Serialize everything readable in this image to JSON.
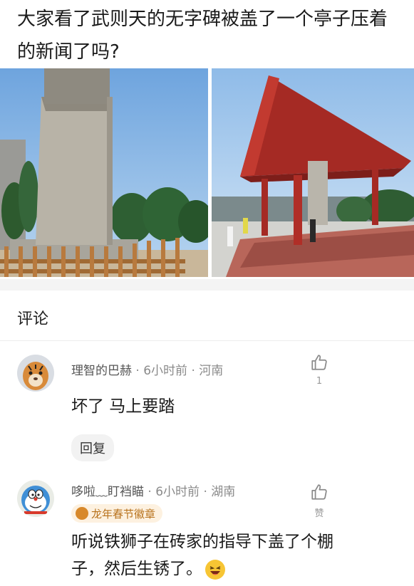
{
  "post": {
    "title": "大家看了武则天的无字碑被盖了一个亭子压着的新闻了吗?"
  },
  "comments_section": {
    "title": "评论"
  },
  "comments": [
    {
      "username": "理智的巴赫",
      "time": "6小时前",
      "location": "河南",
      "separator": "·",
      "like_count": "1",
      "text": "坏了 马上要踏",
      "reply_label": "回复",
      "avatar_icon": "tiger-avatar-icon"
    },
    {
      "username": "哆啦﹏盯裆瞄",
      "time": "6小时前",
      "location": "湖南",
      "separator": "·",
      "like_label": "赞",
      "badge": "龙年春节徽章",
      "text_line1": "听说铁狮子在砖家的指导下盖了个棚",
      "text_line2": "子，然后生锈了。",
      "avatar_icon": "doraemon-avatar-icon"
    }
  ],
  "colors": {
    "accent_red": "#a52a24",
    "badge_text": "#b8721c",
    "meta_gray": "#8a8a8a"
  }
}
